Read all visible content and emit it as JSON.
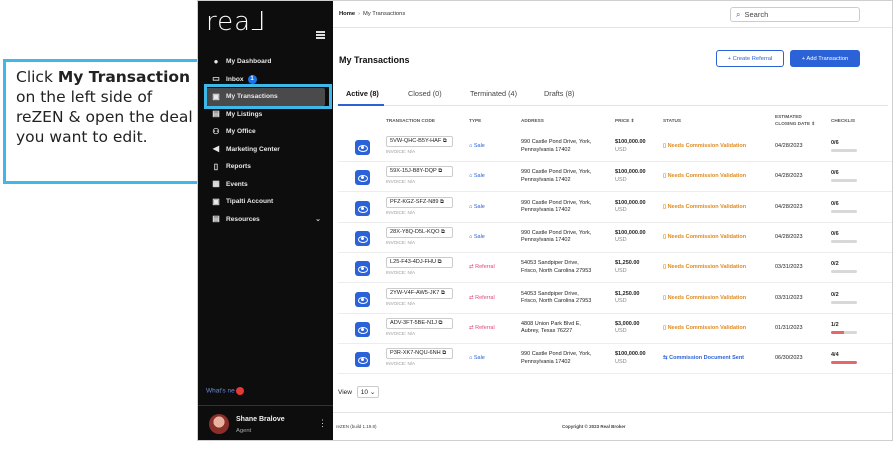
{
  "callout": {
    "prefix": "Click ",
    "bold": "My Transaction",
    "suffix": " on the left side of reZEN & open the deal you want to edit.",
    "border_color": "#3fb8e8"
  },
  "sidebar": {
    "logo": "rea⅃",
    "items": [
      {
        "label": "My Dashboard",
        "icon": "person-icon",
        "glyph": "●"
      },
      {
        "label": "Inbox",
        "icon": "inbox-icon",
        "glyph": "▭",
        "badge": "1"
      },
      {
        "label": "My Transactions",
        "icon": "transactions-icon",
        "glyph": "▣",
        "active": true
      },
      {
        "label": "My Listings",
        "icon": "listings-icon",
        "glyph": "▤"
      },
      {
        "label": "My Office",
        "icon": "office-icon",
        "glyph": "⚇"
      },
      {
        "label": "Marketing Center",
        "icon": "megaphone-icon",
        "glyph": "◀"
      },
      {
        "label": "Reports",
        "icon": "reports-icon",
        "glyph": "▯"
      },
      {
        "label": "Events",
        "icon": "calendar-icon",
        "glyph": "▦"
      },
      {
        "label": "Tipalti Account",
        "icon": "account-icon",
        "glyph": "▣"
      },
      {
        "label": "Resources",
        "icon": "resources-icon",
        "glyph": "▤",
        "expandable": true
      }
    ],
    "whats_new": "What's ne",
    "user": {
      "name": "Shane Bralove",
      "role": "Agent"
    }
  },
  "header": {
    "breadcrumb_home": "Home",
    "breadcrumb_sep": "›",
    "breadcrumb_current": "My Transactions",
    "search_placeholder": "Search"
  },
  "page": {
    "title": "My Transactions",
    "create_referral": "+ Create Referral",
    "add_transaction": "+ Add Transaction"
  },
  "tabs": [
    {
      "label": "Active (8)",
      "active": true
    },
    {
      "label": "Closed (0)"
    },
    {
      "label": "Terminated (4)"
    },
    {
      "label": "Drafts (8)"
    }
  ],
  "columns": {
    "code": "TRANSACTION CODE",
    "type": "TYPE",
    "address": "ADDRESS",
    "price": "PRICE ⇕",
    "status": "STATUS",
    "closing_line1": "ESTIMATED",
    "closing_line2": "CLOSING DATE ⇕",
    "checklist": "CHECKLIS"
  },
  "rows": [
    {
      "code": "5VW-QHC-B5Y-HAF",
      "invoice": "INVOICE: N/A",
      "type": "Sale",
      "type_kind": "sale",
      "addr1": "990 Castle Pond Drive, York,",
      "addr2": "Pennsylvania 17402",
      "price": "$100,000.00",
      "currency": "USD",
      "status": "Needs Commission Validation",
      "status_kind": "warn",
      "date": "04/28/2023",
      "check": "0/6",
      "progress": 0
    },
    {
      "code": "59X-15J-B8Y-DQP",
      "invoice": "INVOICE: N/A",
      "type": "Sale",
      "type_kind": "sale",
      "addr1": "990 Castle Pond Drive, York,",
      "addr2": "Pennsylvania 17402",
      "price": "$100,000.00",
      "currency": "USD",
      "status": "Needs Commission Validation",
      "status_kind": "warn",
      "date": "04/28/2023",
      "check": "0/6",
      "progress": 0
    },
    {
      "code": "PFZ-KGZ-SFZ-N89",
      "invoice": "INVOICE: N/A",
      "type": "Sale",
      "type_kind": "sale",
      "addr1": "990 Castle Pond Drive, York,",
      "addr2": "Pennsylvania 17402",
      "price": "$100,000.00",
      "currency": "USD",
      "status": "Needs Commission Validation",
      "status_kind": "warn",
      "date": "04/28/2023",
      "check": "0/6",
      "progress": 0
    },
    {
      "code": "28X-Y8Q-D5L-KQO",
      "invoice": "INVOICE: N/A",
      "type": "Sale",
      "type_kind": "sale",
      "addr1": "990 Castle Pond Drive, York,",
      "addr2": "Pennsylvania 17402",
      "price": "$100,000.00",
      "currency": "USD",
      "status": "Needs Commission Validation",
      "status_kind": "warn",
      "date": "04/28/2023",
      "check": "0/6",
      "progress": 0
    },
    {
      "code": "L25-F43-4DJ-FHU",
      "invoice": "INVOICE: N/A",
      "type": "Referral",
      "type_kind": "referral",
      "addr1": "54053 Sandpiper Drive,",
      "addr2": "Frisco, North Carolina 27953",
      "price": "$1,250.00",
      "currency": "USD",
      "status": "Needs Commission Validation",
      "status_kind": "warn",
      "date": "03/31/2023",
      "check": "0/2",
      "progress": 0
    },
    {
      "code": "2YW-V4F-AW5-JK7",
      "invoice": "INVOICE: N/A",
      "type": "Referral",
      "type_kind": "referral",
      "addr1": "54053 Sandpiper Drive,",
      "addr2": "Frisco, North Carolina 27953",
      "price": "$1,250.00",
      "currency": "USD",
      "status": "Needs Commission Validation",
      "status_kind": "warn",
      "date": "03/31/2023",
      "check": "0/2",
      "progress": 0
    },
    {
      "code": "ADV-3FT-5BE-N1J",
      "invoice": "INVOICE: N/A",
      "type": "Referral",
      "type_kind": "referral",
      "addr1": "4808 Union Park Blvd E,",
      "addr2": "Aubrey, Texas 76227",
      "price": "$3,000.00",
      "currency": "USD",
      "status": "Needs Commission Validation",
      "status_kind": "warn",
      "date": "01/31/2023",
      "check": "1/2",
      "progress": 0.5
    },
    {
      "code": "P3R-XK7-NQU-6NH",
      "invoice": "INVOICE: N/A",
      "type": "Sale",
      "type_kind": "sale",
      "addr1": "990 Castle Pond Drive, York,",
      "addr2": "Pennsylvania 17402",
      "price": "$100,000.00",
      "currency": "USD",
      "status": "Commission Document Sent",
      "status_kind": "sent",
      "date": "06/30/2023",
      "check": "4/4",
      "progress": 1
    }
  ],
  "pager": {
    "label": "View",
    "value": "10 ⌄"
  },
  "footer": {
    "version": "reZEN (build 1.19.8)",
    "copyright": "Copyright © 2023 Real Broker"
  },
  "colors": {
    "accent": "#2b62d8",
    "warning": "#e08a1e",
    "referral": "#e0457b",
    "sidebar": "#0d0d0d"
  }
}
